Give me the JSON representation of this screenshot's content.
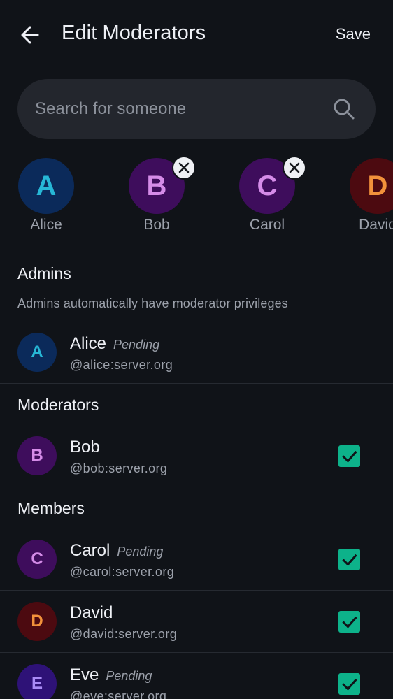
{
  "header": {
    "title": "Edit Moderators",
    "save_label": "Save",
    "back_icon": "arrow-left-icon"
  },
  "search": {
    "placeholder": "Search for someone",
    "value": "",
    "icon": "search-icon"
  },
  "selected": [
    {
      "initial": "A",
      "name": "Alice",
      "removable": false
    },
    {
      "initial": "B",
      "name": "Bob",
      "removable": true
    },
    {
      "initial": "C",
      "name": "Carol",
      "removable": true
    },
    {
      "initial": "D",
      "name": "David",
      "removable": true
    }
  ],
  "admins": {
    "title": "Admins",
    "description": "Admins automatically have moderator privileges",
    "rows": [
      {
        "initial": "A",
        "name": "Alice",
        "status": "Pending",
        "mxid": "@alice:server.org",
        "checked": null
      }
    ]
  },
  "moderators": {
    "title": "Moderators",
    "rows": [
      {
        "initial": "B",
        "name": "Bob",
        "status": "",
        "mxid": "@bob:server.org",
        "checked": true
      }
    ]
  },
  "members": {
    "title": "Members",
    "rows": [
      {
        "initial": "C",
        "name": "Carol",
        "status": "Pending",
        "mxid": "@carol:server.org",
        "checked": true
      },
      {
        "initial": "D",
        "name": "David",
        "status": "",
        "mxid": "@david:server.org",
        "checked": true
      },
      {
        "initial": "E",
        "name": "Eve",
        "status": "Pending",
        "mxid": "@eve:server.org",
        "checked": true
      }
    ]
  },
  "colors": {
    "background": "#101318",
    "surface": "#23262d",
    "accent_checkbox": "#0db28a",
    "text_primary": "#eef0f5",
    "text_secondary": "#9ca1ab"
  }
}
